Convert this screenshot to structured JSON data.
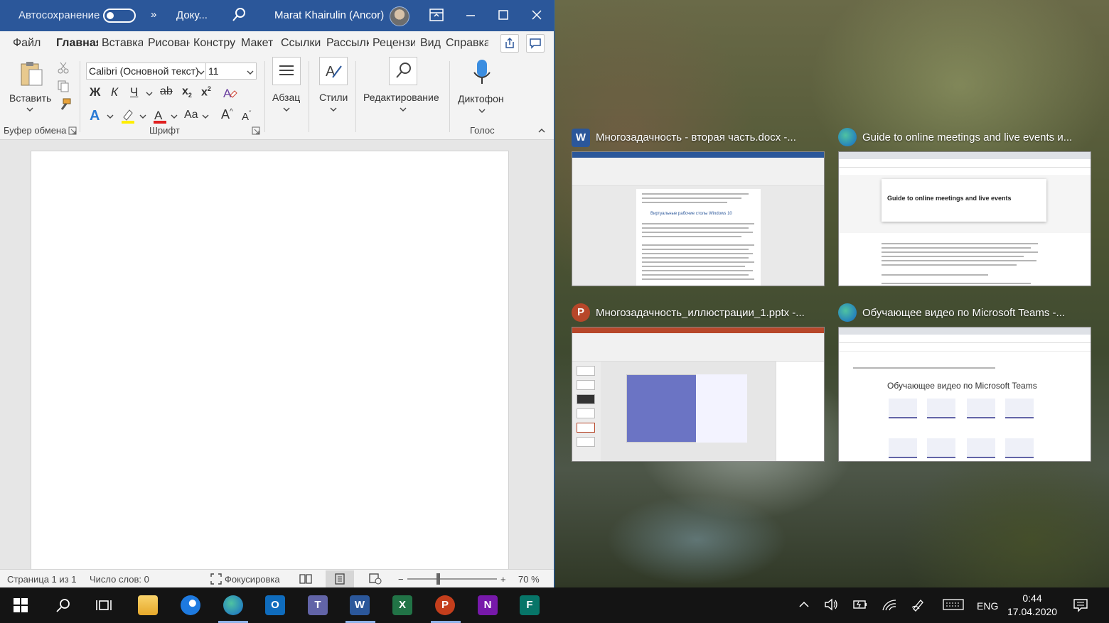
{
  "word": {
    "autosave_label": "Автосохранение",
    "more": "»",
    "doc_short": "Доку...",
    "user": "Marat Khairulin (Ancor)",
    "tabs": [
      "Файл",
      "Главная",
      "Вставка",
      "Рисование",
      "Конструктор",
      "Макет",
      "Ссылки",
      "Рассылки",
      "Рецензирование",
      "Вид",
      "Справка"
    ],
    "ribbon": {
      "paste": "Вставить",
      "clipboard_group": "Буфер обмена",
      "font_name": "Calibri (Основной текст)",
      "font_size": "11",
      "bold": "Ж",
      "italic": "К",
      "underline": "Ч",
      "strike": "ab",
      "sub": "x",
      "sub_mark": "2",
      "sup": "x",
      "sup_mark": "2",
      "case": "Aa",
      "grow": "A",
      "grow_mark": "^",
      "shrink": "A",
      "shrink_mark": "ˇ",
      "font_group": "Шрифт",
      "paragraph": "Абзац",
      "styles": "Стили",
      "editing": "Редактирование",
      "dictate": "Диктофон",
      "voice_group": "Голос"
    },
    "status": {
      "page": "Страница 1 из 1",
      "words": "Число слов: 0",
      "focus": "Фокусировка",
      "zoom_minus": "−",
      "zoom_plus": "+",
      "zoom": "70 %"
    }
  },
  "snap": {
    "items": [
      {
        "title": "Многозадачность - вторая часть.docx -..."
      },
      {
        "title": "Guide to online meetings and live events и..."
      },
      {
        "title": "Многозадачность_иллюстрации_1.pptx -..."
      },
      {
        "title": "Обучающее видео по Microsoft Teams -..."
      }
    ],
    "thumb_word_heading": "Виртуальные рабочие столы Windows 10",
    "thumb_edge_title": "Guide to online meetings and live events",
    "thumb_teams_title": "Обучающее видео по Microsoft Teams"
  },
  "taskbar": {
    "lang": "ENG",
    "time": "0:44",
    "date": "17.04.2020"
  },
  "colors": {
    "word_blue": "#2b579a",
    "ppt_orange": "#b7472a",
    "excel_green": "#217346",
    "teams_purple": "#6264a7"
  }
}
